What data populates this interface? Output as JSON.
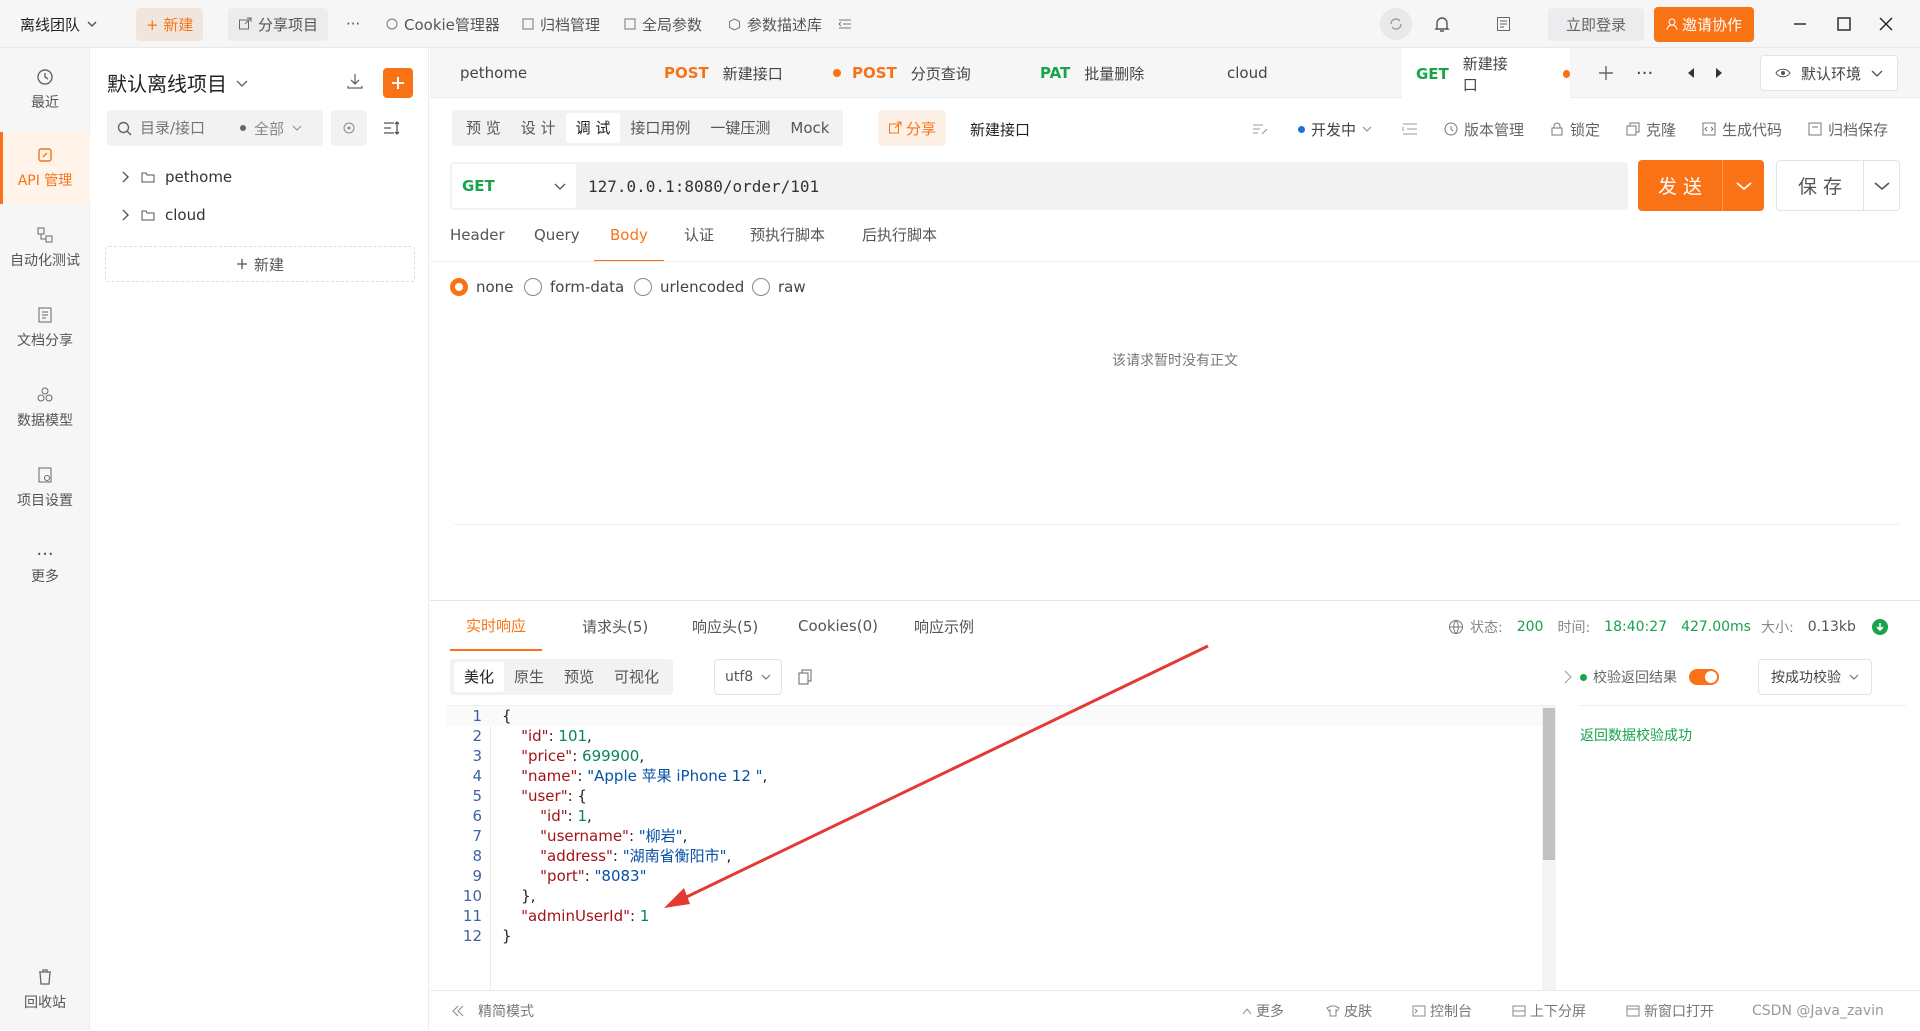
{
  "topbar": {
    "team": "离线团队",
    "new_btn": "+ 新建",
    "share_project": "分享项目",
    "more": "···",
    "cookie_mgr": "Cookie管理器",
    "archive_mgr": "归档管理",
    "global_params": "全局参数",
    "param_db": "参数描述库",
    "login": "立即登录",
    "invite": "邀请协作"
  },
  "nav": [
    {
      "label": "最近"
    },
    {
      "label": "API 管理"
    },
    {
      "label": "自动化测试"
    },
    {
      "label": "文档分享"
    },
    {
      "label": "数据模型"
    },
    {
      "label": "项目设置"
    },
    {
      "label": "更多"
    },
    {
      "label": "回收站"
    }
  ],
  "project": {
    "title": "默认离线项目",
    "search_placeholder": "目录/接口",
    "filter": "全部",
    "folders": [
      "pethome",
      "cloud"
    ],
    "new_label": "新建"
  },
  "tabs": [
    {
      "method": "",
      "name": "pethome"
    },
    {
      "method": "POST",
      "name": "新建接口"
    },
    {
      "method": "POST",
      "name": "分页查询"
    },
    {
      "method": "PAT",
      "name": "批量删除"
    },
    {
      "method": "",
      "name": "cloud"
    },
    {
      "method": "GET",
      "name": "新建接口"
    }
  ],
  "env": "默认环境",
  "toolrow": {
    "modes": [
      "预 览",
      "设 计",
      "调 试",
      "接口用例",
      "一键压测",
      "Mock"
    ],
    "share": "分享",
    "api_name": "新建接口",
    "status": "开发中",
    "version": "版本管理",
    "lock": "锁定",
    "clone": "克隆",
    "gencode": "生成代码",
    "archive_save": "归档保存"
  },
  "request": {
    "method": "GET",
    "url": "127.0.0.1:8080/order/101",
    "send": "发 送",
    "save": "保 存",
    "tabs": [
      "Header",
      "Query",
      "Body",
      "认证",
      "预执行脚本",
      "后执行脚本"
    ],
    "body_types": [
      "none",
      "form-data",
      "urlencoded",
      "raw"
    ],
    "empty_body": "该请求暂时没有正文"
  },
  "response": {
    "tabs": [
      "实时响应",
      "请求头(5)",
      "响应头(5)",
      "Cookies(0)",
      "响应示例"
    ],
    "status_label": "状态:",
    "status": "200",
    "time_label": "时间:",
    "time": "18:40:27",
    "duration": "427.00ms",
    "size_label": "大小:",
    "size": "0.13kb",
    "formats": [
      "美化",
      "原生",
      "预览",
      "可视化"
    ],
    "encoding": "utf8",
    "validate_label": "校验返回结果",
    "validate_mode": "按成功校验",
    "validate_result": "返回数据校验成功",
    "code_lines": [
      {
        "n": "1",
        "t": "{"
      },
      {
        "n": "2",
        "t": "    \"id\": 101,"
      },
      {
        "n": "3",
        "t": "    \"price\": 699900,"
      },
      {
        "n": "4",
        "t": "    \"name\": \"Apple 苹果 iPhone 12 \","
      },
      {
        "n": "5",
        "t": "    \"user\": {"
      },
      {
        "n": "6",
        "t": "        \"id\": 1,"
      },
      {
        "n": "7",
        "t": "        \"username\": \"柳岩\","
      },
      {
        "n": "8",
        "t": "        \"address\": \"湖南省衡阳市\","
      },
      {
        "n": "9",
        "t": "        \"port\": \"8083\""
      },
      {
        "n": "10",
        "t": "    },"
      },
      {
        "n": "11",
        "t": "    \"adminUserId\": 1"
      },
      {
        "n": "12",
        "t": "}"
      }
    ]
  },
  "footer": {
    "simple_mode": "精简模式",
    "more": "更多",
    "skin": "皮肤",
    "console": "控制台",
    "split": "上下分屏",
    "new_window": "新窗口打开",
    "watermark": "CSDN @Java_zavin"
  },
  "colors": {
    "accent": "#f97316",
    "green": "#16a34a",
    "blue": "#1e6fd9"
  }
}
